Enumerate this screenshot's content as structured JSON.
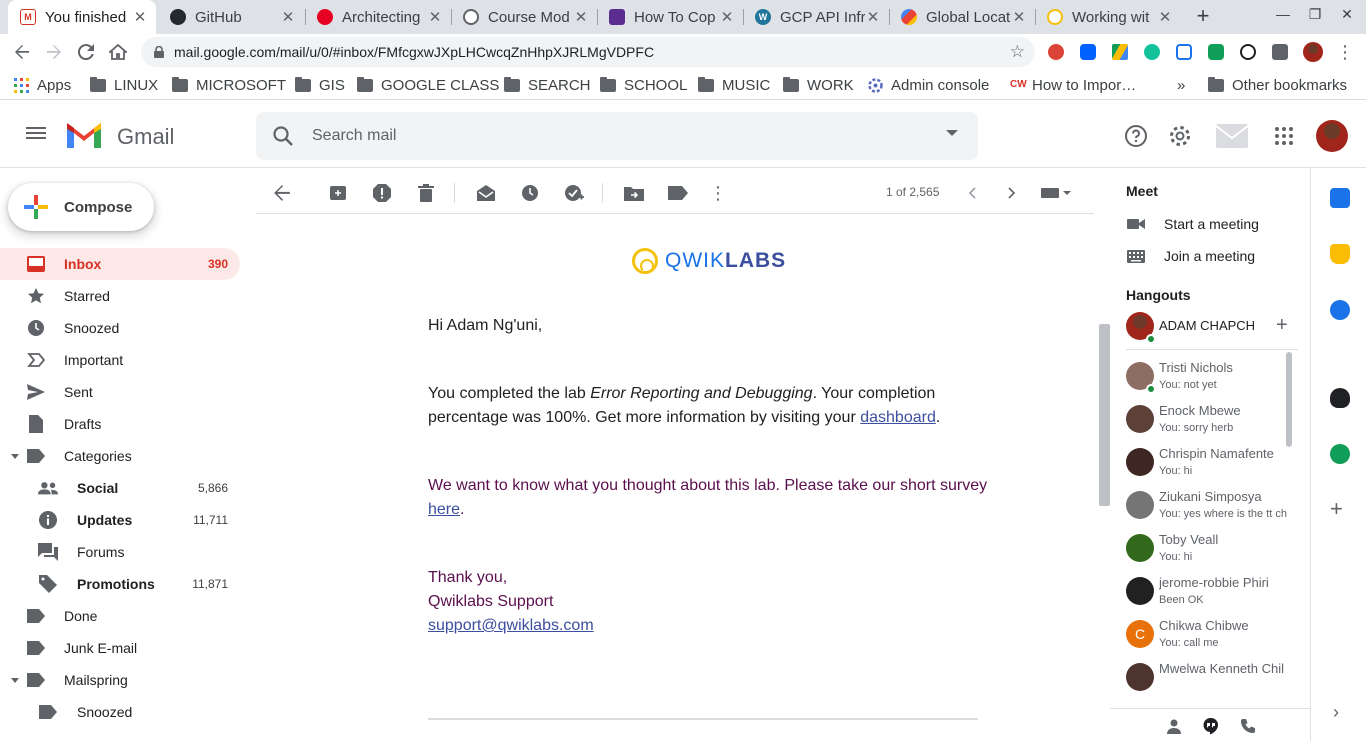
{
  "browser": {
    "tabs": [
      {
        "title": "You finished",
        "favicon_color": "#d93025",
        "active": true
      },
      {
        "title": "GitHub",
        "favicon_color": "#24292e"
      },
      {
        "title": "Architecting",
        "favicon_color": "#e60023"
      },
      {
        "title": "Course Mod",
        "favicon_color": "#5f6368"
      },
      {
        "title": "How To Cop",
        "favicon_color": "#5c2d91"
      },
      {
        "title": "GCP API Infr",
        "favicon_color": "#21759b"
      },
      {
        "title": "Global Locat",
        "favicon_color": "#4285f4"
      },
      {
        "title": "Working wit",
        "favicon_color": "#f4c20d"
      }
    ],
    "new_tab": "+",
    "url": "mail.google.com/mail/u/0/#inbox/FMfcgxwJXpLHCwcqZnHhpXJRLMgVDPFC",
    "bookmarks": [
      {
        "label": "Apps",
        "icon": "apps-grid-icon"
      },
      {
        "label": "LINUX",
        "icon": "folder-icon"
      },
      {
        "label": "MICROSOFT",
        "icon": "folder-icon"
      },
      {
        "label": "GIS",
        "icon": "folder-icon"
      },
      {
        "label": "GOOGLE CLASS",
        "icon": "folder-icon"
      },
      {
        "label": "SEARCH",
        "icon": "folder-icon"
      },
      {
        "label": "SCHOOL",
        "icon": "folder-icon"
      },
      {
        "label": "MUSIC",
        "icon": "folder-icon"
      },
      {
        "label": "WORK",
        "icon": "folder-icon"
      },
      {
        "label": "Admin console",
        "icon": "admin-icon"
      },
      {
        "label": "How to Impor…",
        "icon": "site-icon"
      }
    ],
    "bookmarks_overflow": "»",
    "other_bookmarks": "Other bookmarks"
  },
  "gmail": {
    "brand": "Gmail",
    "search_placeholder": "Search mail",
    "compose": "Compose",
    "nav": [
      {
        "label": "Inbox",
        "count": "390",
        "icon": "inbox-icon",
        "active": true
      },
      {
        "label": "Starred",
        "count": "",
        "icon": "star-icon"
      },
      {
        "label": "Snoozed",
        "count": "",
        "icon": "clock-icon"
      },
      {
        "label": "Important",
        "count": "",
        "icon": "important-icon"
      },
      {
        "label": "Sent",
        "count": "",
        "icon": "send-icon"
      },
      {
        "label": "Drafts",
        "count": "",
        "icon": "draft-icon"
      },
      {
        "label": "Categories",
        "count": "",
        "icon": "label-icon",
        "expand": true
      },
      {
        "label": "Social",
        "count": "5,866",
        "icon": "people-icon",
        "sub": true,
        "bold": true
      },
      {
        "label": "Updates",
        "count": "11,711",
        "icon": "info-icon",
        "sub": true,
        "bold": true
      },
      {
        "label": "Forums",
        "count": "",
        "icon": "forum-icon",
        "sub": true
      },
      {
        "label": "Promotions",
        "count": "11,871",
        "icon": "tag-icon",
        "sub": true,
        "bold": true
      },
      {
        "label": "Done",
        "count": "",
        "icon": "label-icon"
      },
      {
        "label": "Junk E-mail",
        "count": "",
        "icon": "label-icon"
      },
      {
        "label": "Mailspring",
        "count": "",
        "icon": "label-icon",
        "expand": true
      },
      {
        "label": "Snoozed",
        "count": "",
        "icon": "label-icon",
        "sub": true
      }
    ],
    "pager": "1 of 2,565",
    "message": {
      "logo_word1": "QWIK",
      "logo_word2": "LABS",
      "greeting": "Hi Adam Ng'uni,",
      "p1_a": "You completed the lab ",
      "p1_lab": "Error Reporting and Debugging",
      "p1_b": ". Your completion percentage was 100%. Get more information by visiting your ",
      "p1_link": "dashboard",
      "p1_end": ".",
      "p2_a": "We want to know what you thought about this lab. Please take our short survey ",
      "p2_link": "here",
      "p2_end": ".",
      "signoff": "Thank you,",
      "signature": "Qwiklabs Support",
      "email": "support@qwiklabs.com"
    },
    "meet": {
      "title": "Meet",
      "start": "Start a meeting",
      "join": "Join a meeting"
    },
    "hangouts": {
      "title": "Hangouts",
      "self": "ADAM CHAPCH",
      "contacts": [
        {
          "name": "Tristi Nichols",
          "last": "You: not yet",
          "color": "#8d6e63",
          "online": true
        },
        {
          "name": "Enock Mbewe",
          "last": "You: sorry herb",
          "color": "#5d4037"
        },
        {
          "name": "Chrispin Namafente",
          "last": "You: hi",
          "color": "#3e2723"
        },
        {
          "name": "Ziukani Simposya",
          "last": "You: yes where is the tt ch",
          "color": "#757575"
        },
        {
          "name": "Toby Veall",
          "last": "You: hi",
          "color": "#33691e"
        },
        {
          "name": "jerome-robbie Phiri",
          "last": "Been OK",
          "color": "#212121"
        },
        {
          "name": "Chikwa Chibwe",
          "last": "You: call me",
          "color": "#e8710a",
          "initial": "C"
        },
        {
          "name": "Mwelwa Kenneth Chil",
          "last": "",
          "color": "#4e342e"
        }
      ]
    }
  }
}
